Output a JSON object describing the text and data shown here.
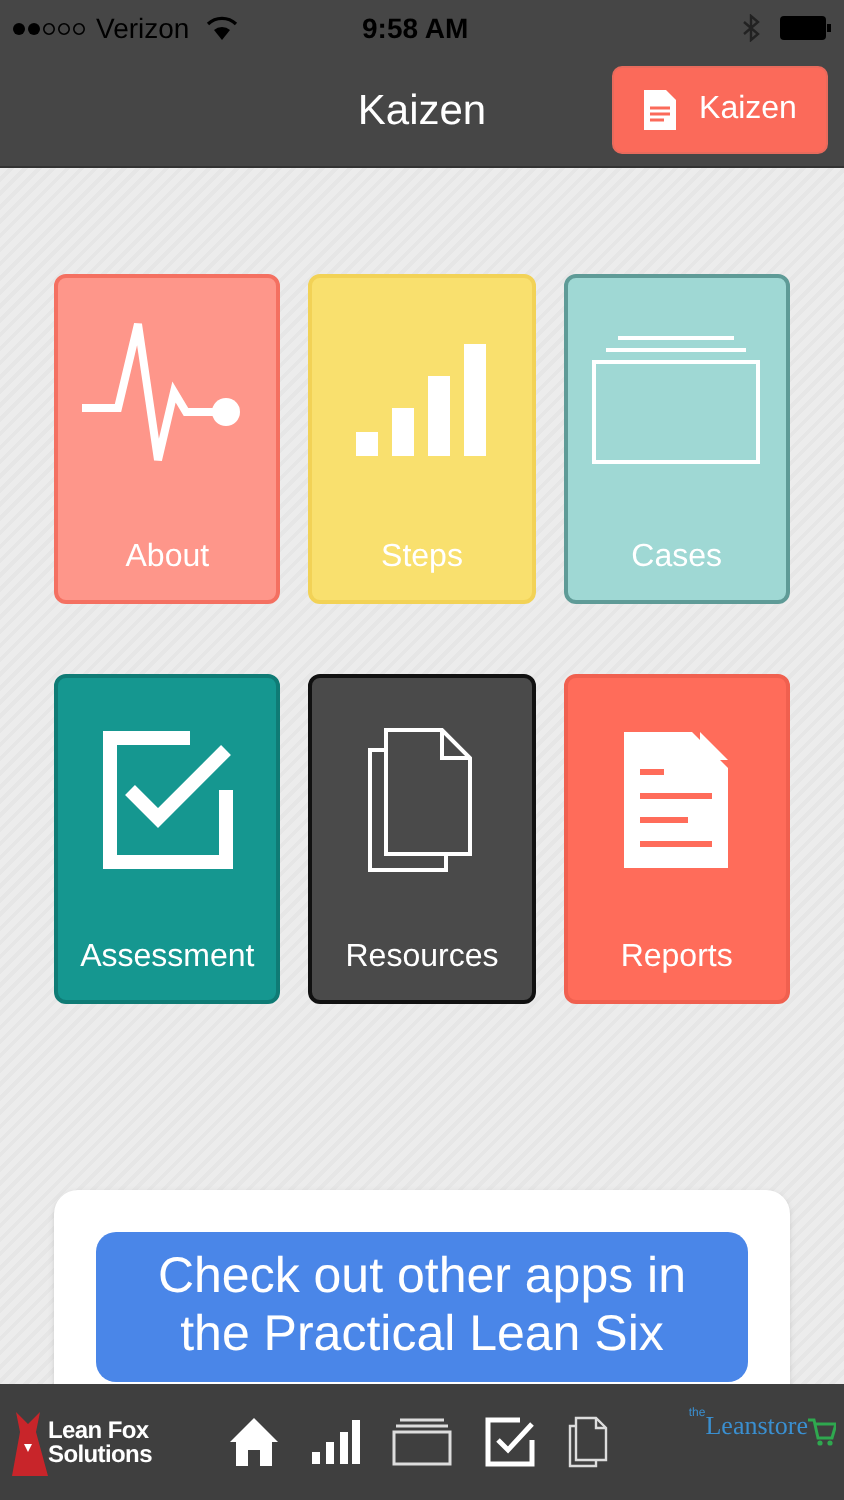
{
  "status_bar": {
    "carrier": "Verizon",
    "time": "9:58 AM"
  },
  "nav_bar": {
    "title": "Kaizen",
    "button": "Kaizen"
  },
  "tiles": [
    {
      "label": "About",
      "kind": "pulse",
      "color": "#fe968a"
    },
    {
      "label": "Steps",
      "kind": "bars",
      "color": "#f9e06e"
    },
    {
      "label": "Cases",
      "kind": "cases",
      "color": "#9fd8d4"
    },
    {
      "label": "Assessment",
      "kind": "check",
      "color": "#159790"
    },
    {
      "label": "Resources",
      "kind": "docs",
      "color": "#4a4a4a"
    },
    {
      "label": "Reports",
      "kind": "report",
      "color": "#ff6c5a"
    }
  ],
  "promo": {
    "button": "Check out other apps in the Practical Lean Six"
  },
  "bottom_bar": {
    "left_logo": [
      "Lean Fox",
      "Solutions"
    ],
    "tabs": [
      {
        "kind": "home"
      },
      {
        "kind": "bars"
      },
      {
        "kind": "cases"
      },
      {
        "kind": "check"
      },
      {
        "kind": "docs"
      }
    ],
    "right_logo": {
      "small": "the",
      "main": "Leanstore"
    }
  }
}
